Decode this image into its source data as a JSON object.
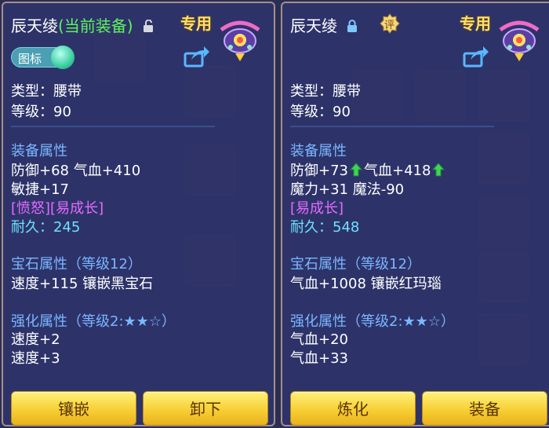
{
  "left": {
    "name": "辰天绫",
    "status": "(当前装备)",
    "exclusive": "专用",
    "toggle_label": "图标",
    "type_line": "类型：腰带",
    "level_line": "等级：90",
    "equip_attr_title": "装备属性",
    "attr_line1": "防御+68 气血+410",
    "attr_line2": "敏捷+17",
    "special": "[愤怒][易成长]",
    "durability_label": "耐久：",
    "durability_value": "245",
    "gem_title": "宝石属性（等级12）",
    "gem_line": "速度+115 镶嵌黑宝石",
    "enhance_title": "强化属性（等级2:★★☆）",
    "enhance_line1": "速度+2",
    "enhance_line2": "速度+3",
    "buttons": [
      "镶嵌",
      "卸下"
    ]
  },
  "right": {
    "name": "辰天绫",
    "exclusive": "专用",
    "badge": "评",
    "type_line": "类型：腰带",
    "level_line": "等级：90",
    "equip_attr_title": "装备属性",
    "attr1": "防御+73",
    "attr2": "气血+418",
    "attr_line2": "魔力+31 魔法-90",
    "special": "[易成长]",
    "durability_label": "耐久：",
    "durability_value": "548",
    "gem_title": "宝石属性（等级12）",
    "gem_line": "气血+1008 镶嵌红玛瑙",
    "enhance_title": "强化属性（等级2:★★☆）",
    "enhance_line1": "气血+20",
    "enhance_line2": "气血+33",
    "buttons": [
      "炼化",
      "装备"
    ]
  },
  "icons": {
    "lock_open": "unlock-icon",
    "lock_closed": "lock-icon",
    "share": "share-icon",
    "pet": "pet-icon",
    "arrow": "up-arrow-icon"
  },
  "colors": {
    "panel_bg": "#2e346e",
    "panel_border": "#a78e8a",
    "current_equip": "#5ef35c",
    "attr_head": "#7ab6ff",
    "special": "#e36bff",
    "durability": "#6fe0ff",
    "exclusive": "#ffe066",
    "button": "#f7cf35"
  }
}
